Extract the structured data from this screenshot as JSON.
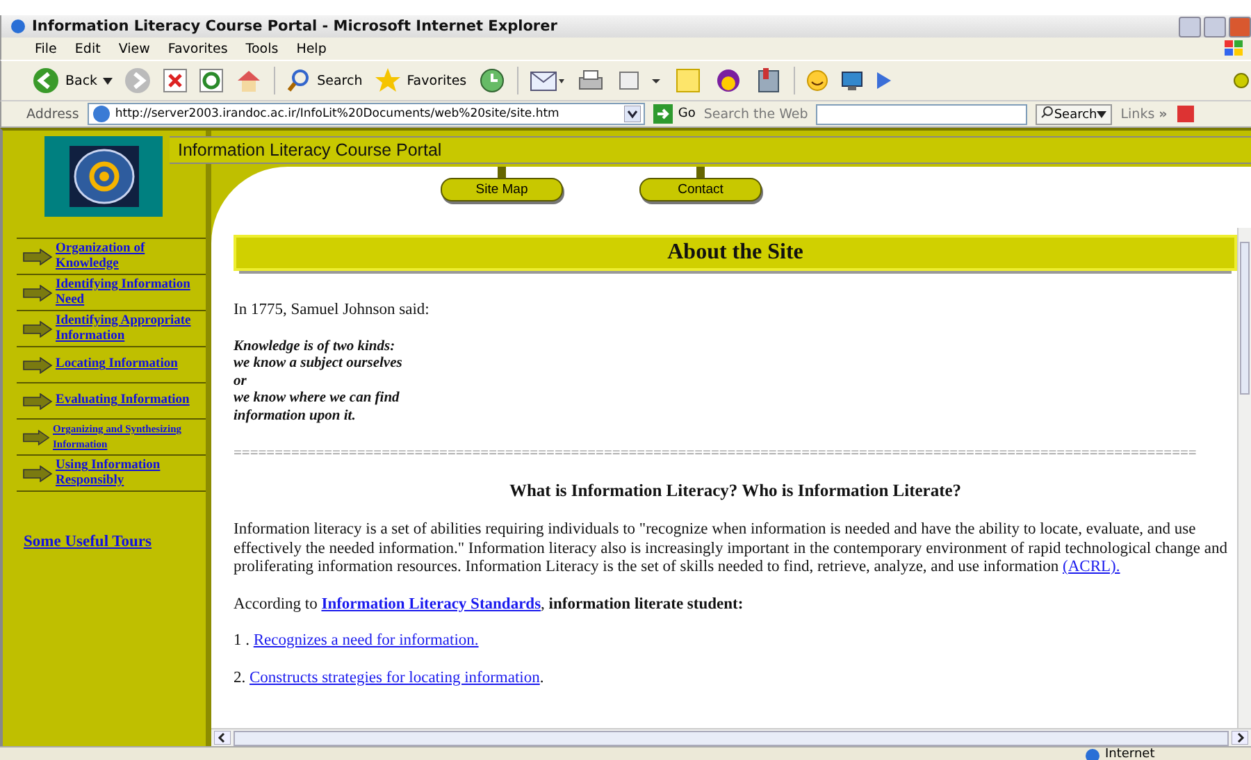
{
  "window": {
    "title": "Information Literacy Course Portal - Microsoft Internet Explorer"
  },
  "menu": [
    "File",
    "Edit",
    "View",
    "Favorites",
    "Tools",
    "Help"
  ],
  "toolbar": {
    "back": "Back",
    "search": "Search",
    "favorites": "Favorites"
  },
  "address_bar": {
    "label": "Address",
    "url": "http://server2003.irandoc.ac.ir/InfoLit%20Documents/web%20site/site.htm",
    "go": "Go",
    "search_label": "Search the Web",
    "search_button": "Search",
    "links": "Links",
    "more": "»"
  },
  "site": {
    "title": "Information Literacy Course Portal",
    "nav_buttons": [
      "Site Map",
      "Contact"
    ],
    "sidebar": [
      {
        "label": "Organization of Knowledge",
        "small": false
      },
      {
        "label": "Identifying Information Need",
        "small": false
      },
      {
        "label": "Identifying Appropriate Information",
        "small": false
      },
      {
        "label": "Locating Information",
        "small": false
      },
      {
        "label": "Evaluating Information",
        "small": false
      },
      {
        "label": "Organizing and Synthesizing Information",
        "small": true
      },
      {
        "label": "Using Information Responsibly",
        "small": false
      }
    ],
    "tours_link": "Some Useful Tours"
  },
  "content": {
    "heading": "About the Site",
    "intro": "In 1775, Samuel Johnson said:",
    "quote": [
      "Knowledge is of two kinds:",
      "we know a subject ourselves",
      "or",
      "we know where we can find",
      "information upon it."
    ],
    "separator": "=====================================================================================================================",
    "subheading": "What is Information Literacy? Who is Information Literate?",
    "paragraph": {
      "text": "Information literacy is a set of abilities requiring individuals to \"recognize when information is needed and have the ability to locate, evaluate, and use effectively the needed information.\" Information literacy also is increasingly important in the contemporary environment of rapid technological change and proliferating information resources. Information Literacy is the set of skills needed to find, retrieve, analyze, and use information ",
      "link": "(ACRL)."
    },
    "standards": {
      "before": "According to ",
      "link": "Information Literacy Standards",
      "after": ", **information literate student:**"
    },
    "items": [
      {
        "number": "1 . ",
        "link": "Recognizes a need for information."
      },
      {
        "number": "2. ",
        "link": "Constructs strategies for locating information",
        "after": "."
      }
    ]
  },
  "status_bar": {
    "zone": "Internet"
  }
}
